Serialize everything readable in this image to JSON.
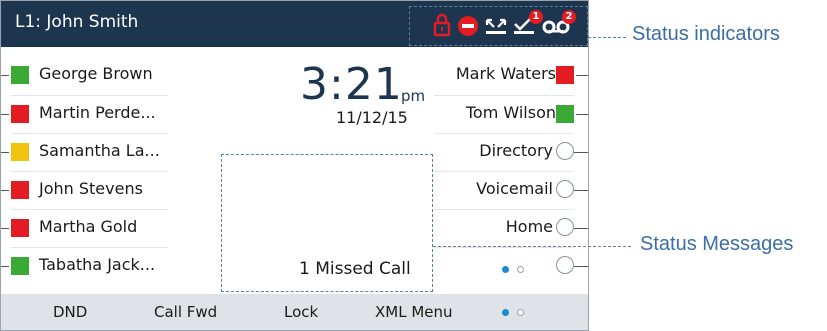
{
  "titlebar": {
    "title": "L1: John Smith",
    "badge_missed": "1",
    "badge_voicemail": "2",
    "icons": [
      "lock-icon",
      "dnd-icon",
      "missed-call-icon",
      "call-forward-icon",
      "voicemail-icon"
    ]
  },
  "left_keys": [
    {
      "label": "George Brown",
      "color": "#3aaa35"
    },
    {
      "label": "Martin Perde...",
      "color": "#e31b23"
    },
    {
      "label": "Samantha La...",
      "color": "#f2c311"
    },
    {
      "label": "John Stevens",
      "color": "#e31b23"
    },
    {
      "label": "Martha Gold",
      "color": "#e31b23"
    },
    {
      "label": "Tabatha Jack...",
      "color": "#3aaa35"
    }
  ],
  "right_keys": [
    {
      "label": "Mark Waters",
      "indicator": "square",
      "color": "#e31b23"
    },
    {
      "label": "Tom Wilson",
      "indicator": "square",
      "color": "#3aaa35"
    },
    {
      "label": "Directory",
      "indicator": "circle"
    },
    {
      "label": "Voicemail",
      "indicator": "circle"
    },
    {
      "label": "Home",
      "indicator": "circle"
    },
    {
      "label": "",
      "indicator": "circle"
    }
  ],
  "clock": {
    "time": "3:21",
    "ampm": "pm",
    "date": "11/12/15"
  },
  "status_message": "1  Missed Call",
  "softkeys": [
    "DND",
    "Call Fwd",
    "Lock",
    "XML Menu"
  ],
  "callouts": {
    "status_indicators": "Status indicators",
    "status_messages": "Status Messages"
  },
  "colors": {
    "titlebar": "#1e3550",
    "accent": "#1a8ad4",
    "callout": "#3b6ea5",
    "alert_red": "#e31b23"
  }
}
